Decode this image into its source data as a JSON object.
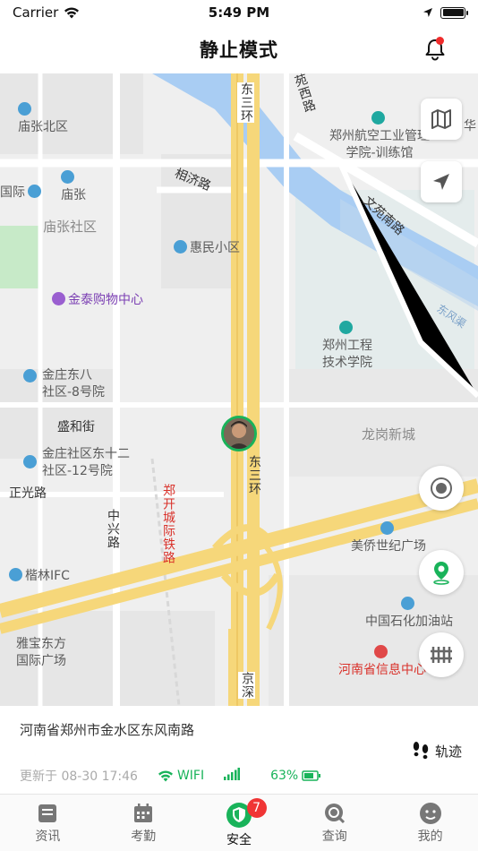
{
  "status_bar": {
    "carrier": "Carrier",
    "time": "5:49 PM"
  },
  "nav": {
    "title": "静止模式"
  },
  "map": {
    "labels": {
      "miaozhang_north": "庙张北区",
      "miaozhang": "庙张",
      "guoji": "国际",
      "miaozhang_community": "庙张社区",
      "jintai_mall": "金泰购物中心",
      "huimin": "惠民小区",
      "jinzhuang_8": "金庄东八\n社区-8号院",
      "shenghe_st": "盛和街",
      "jinzhuang_12": "金庄社区东十二\n社区-12号院",
      "zhengguang_rd": "正光路",
      "zhongxing_rd": "中兴路",
      "zhengkai_railway": "郑开城际铁路",
      "kailin_ifc": "楷林IFC",
      "yabao": "雅宝东方\n国际广场",
      "east_ring_top": "东三环",
      "east_ring_mid": "东三环",
      "jingshen": "京深",
      "xiangji_rd": "相济路",
      "wenyuan_south_rd": "文苑南路",
      "yuanxi_rd": "苑西路",
      "aviation_college": "郑州航空工业管理\n学院-训练馆",
      "hua": "华",
      "dongfeng_canal": "东风渠",
      "zhengzhou_tech": "郑州工程\n技术学院",
      "longgang": "龙岗新城",
      "meiqiao_plaza": "美侨世纪广场",
      "sinopec": "中国石化加油站",
      "henan_info": "河南省信息中心"
    }
  },
  "info": {
    "address": "河南省郑州市金水区东风南路",
    "trail_label": "轨迹",
    "updated": "更新于 08-30 17:46",
    "network": "WIFI",
    "battery": "63%"
  },
  "tabs": [
    {
      "label": "资讯"
    },
    {
      "label": "考勤"
    },
    {
      "label": "安全",
      "badge": "7"
    },
    {
      "label": "查询"
    },
    {
      "label": "我的"
    }
  ],
  "colors": {
    "accent_green": "#19b35a",
    "badge_red": "#f03535",
    "highway_yellow": "#f6d77a",
    "river_blue": "#a9cdf3"
  }
}
